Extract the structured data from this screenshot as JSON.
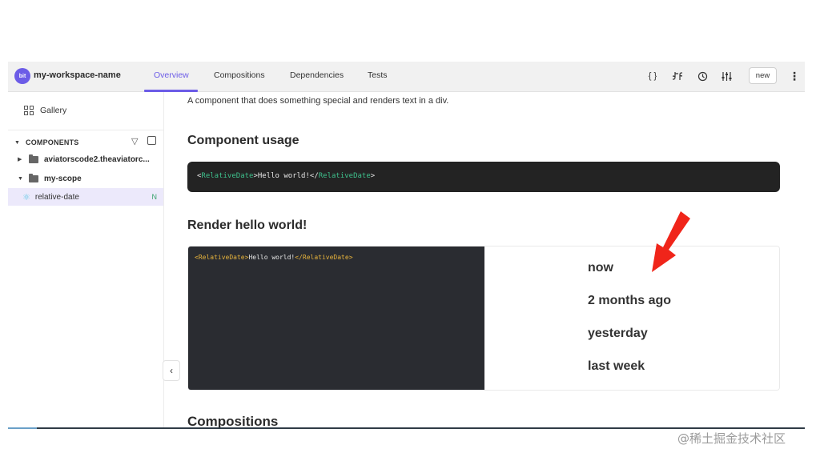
{
  "app": {
    "logo_text": "bit",
    "workspace_name": "my-workspace-name",
    "brand_color": "#6c5ce7"
  },
  "tabs": [
    {
      "label": "Overview",
      "active": true
    },
    {
      "label": "Compositions",
      "active": false
    },
    {
      "label": "Dependencies",
      "active": false
    },
    {
      "label": "Tests",
      "active": false
    }
  ],
  "toolbar": {
    "icons": [
      "code-braces-icon",
      "merge-icon",
      "history-icon",
      "sliders-icon"
    ],
    "code_glyph": "{ }",
    "new_label": "new",
    "more_glyph": "⋮"
  },
  "sidebar": {
    "gallery_label": "Gallery",
    "components_header": "COMPONENTS",
    "tree": [
      {
        "label": "aviatorscode2.theaviatorc...",
        "expanded": false
      },
      {
        "label": "my-scope",
        "expanded": true
      }
    ],
    "selected_component": "relative-date",
    "selected_badge": "N",
    "collapse_glyph": "‹"
  },
  "main": {
    "description": "A component that does something special and renders text in a div.",
    "usage_title": "Component usage",
    "usage_code": {
      "open_tag": "<",
      "component": "RelativeDate",
      "close_open": ">",
      "text": "Hello world!",
      "end_open": "</",
      "end_close": ">"
    },
    "render_title": "Render hello world!",
    "live_code": {
      "open_tag": "<",
      "component": "RelativeDate",
      "close_open": ">",
      "text": "Hello world!",
      "end_open": "</",
      "end_close": ">"
    },
    "output_lines": [
      "now",
      "2 months ago",
      "yesterday",
      "last week"
    ],
    "compositions_title": "Compositions"
  },
  "annotation": {
    "arrow_color": "#f0251a"
  },
  "watermark": "@稀土掘金技术社区"
}
